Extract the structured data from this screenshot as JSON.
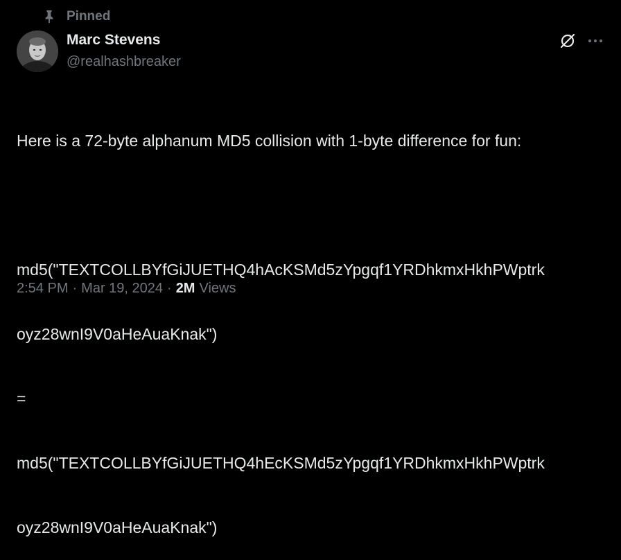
{
  "pinned": {
    "icon": "pin-icon",
    "label": "Pinned"
  },
  "author": {
    "display_name": "Marc Stevens",
    "handle": "@realhashbreaker",
    "avatar_icon": "avatar"
  },
  "actions": {
    "grok_icon": "grok-icon",
    "more_icon": "more-icon"
  },
  "tweet": {
    "lines": [
      "Here is a 72-byte alphanum MD5 collision with 1-byte difference for fun:",
      "",
      "md5(\"TEXTCOLLBYfGiJUETHQ4hAcKSMd5zYpgqf1YRDhkmxHkhPWptrk",
      "oyz28wnI9V0aHeAuaKnak\")",
      "=",
      "md5(\"TEXTCOLLBYfGiJUETHQ4hEcKSMd5zYpgqf1YRDhkmxHkhPWptrk",
      "oyz28wnI9V0aHeAuaKnak\")"
    ]
  },
  "meta": {
    "time": "2:54 PM",
    "separator": "·",
    "date": "Mar 19, 2024",
    "views_count": "2M",
    "views_label": "Views"
  },
  "colors": {
    "background": "#000000",
    "primary_text": "#e7e9ea",
    "secondary_text": "#71767b"
  }
}
